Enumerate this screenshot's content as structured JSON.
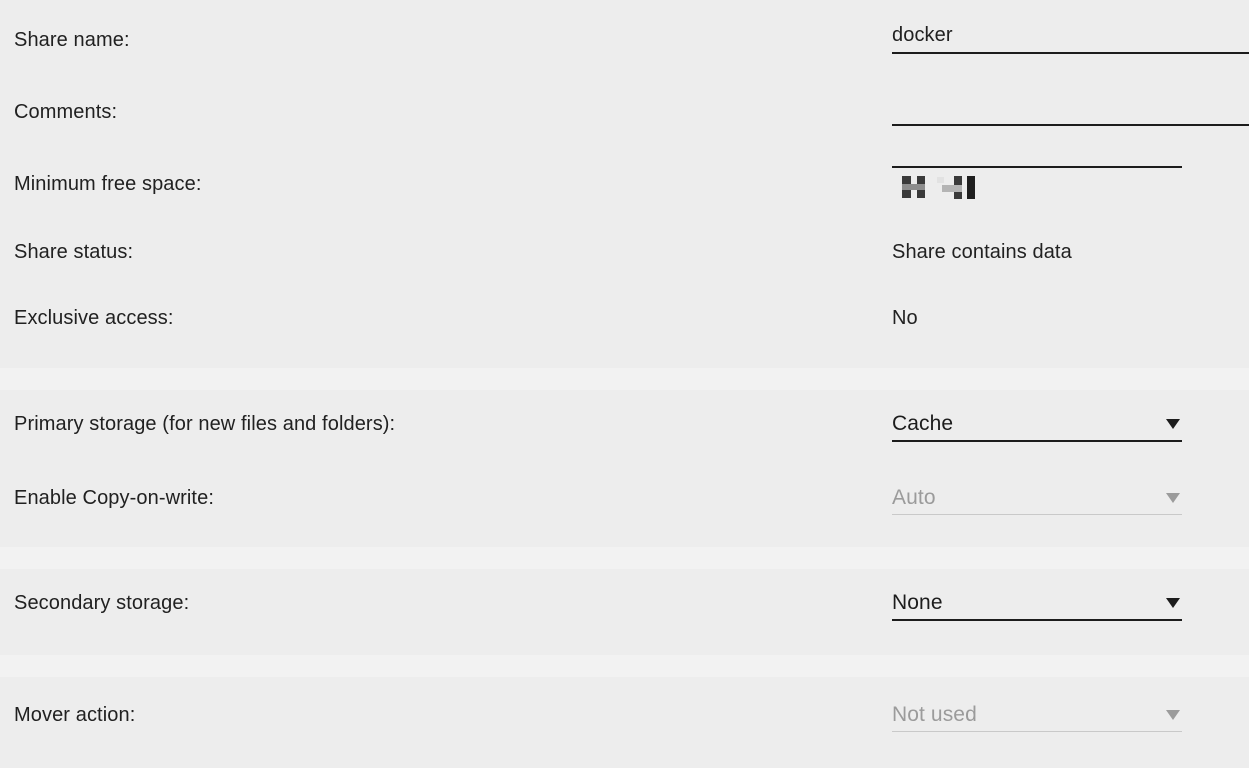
{
  "theme": {
    "page_background": "#f2f2f2",
    "section_background": "#ededed",
    "label_color": "#212121",
    "value_color": "#1c1c1c",
    "disabled_color": "#9b9b9b",
    "underline_color": "#1c1c1c",
    "disabled_underline_color": "#c9c9c9"
  },
  "sections": [
    {
      "name": "share-identity",
      "rows": [
        {
          "label": "Share name:",
          "control": "text-input",
          "value": "docker",
          "placeholder": "",
          "enabled": true
        },
        {
          "label": "Comments:",
          "control": "text-input",
          "value": "",
          "placeholder": "",
          "enabled": true
        },
        {
          "label": "Minimum free space:",
          "control": "pixelated-input",
          "value": "",
          "enabled": true
        },
        {
          "label": "Share status:",
          "control": "static-text",
          "value": "Share contains data",
          "enabled": false
        },
        {
          "label": "Exclusive access:",
          "control": "static-text",
          "value": "No",
          "enabled": false
        }
      ]
    },
    {
      "name": "primary-storage",
      "rows": [
        {
          "label": "Primary storage (for new files and folders):",
          "control": "select",
          "value": "Cache",
          "enabled": true
        },
        {
          "label": "Enable Copy-on-write:",
          "control": "select",
          "value": "Auto",
          "enabled": false
        }
      ]
    },
    {
      "name": "secondary-storage",
      "rows": [
        {
          "label": "Secondary storage:",
          "control": "select",
          "value": "None",
          "enabled": true
        }
      ]
    },
    {
      "name": "mover",
      "rows": [
        {
          "label": "Mover action:",
          "control": "select",
          "value": "Not used",
          "enabled": false
        }
      ]
    }
  ],
  "icons": {
    "dropdown_caret": "chevron-down-icon"
  }
}
